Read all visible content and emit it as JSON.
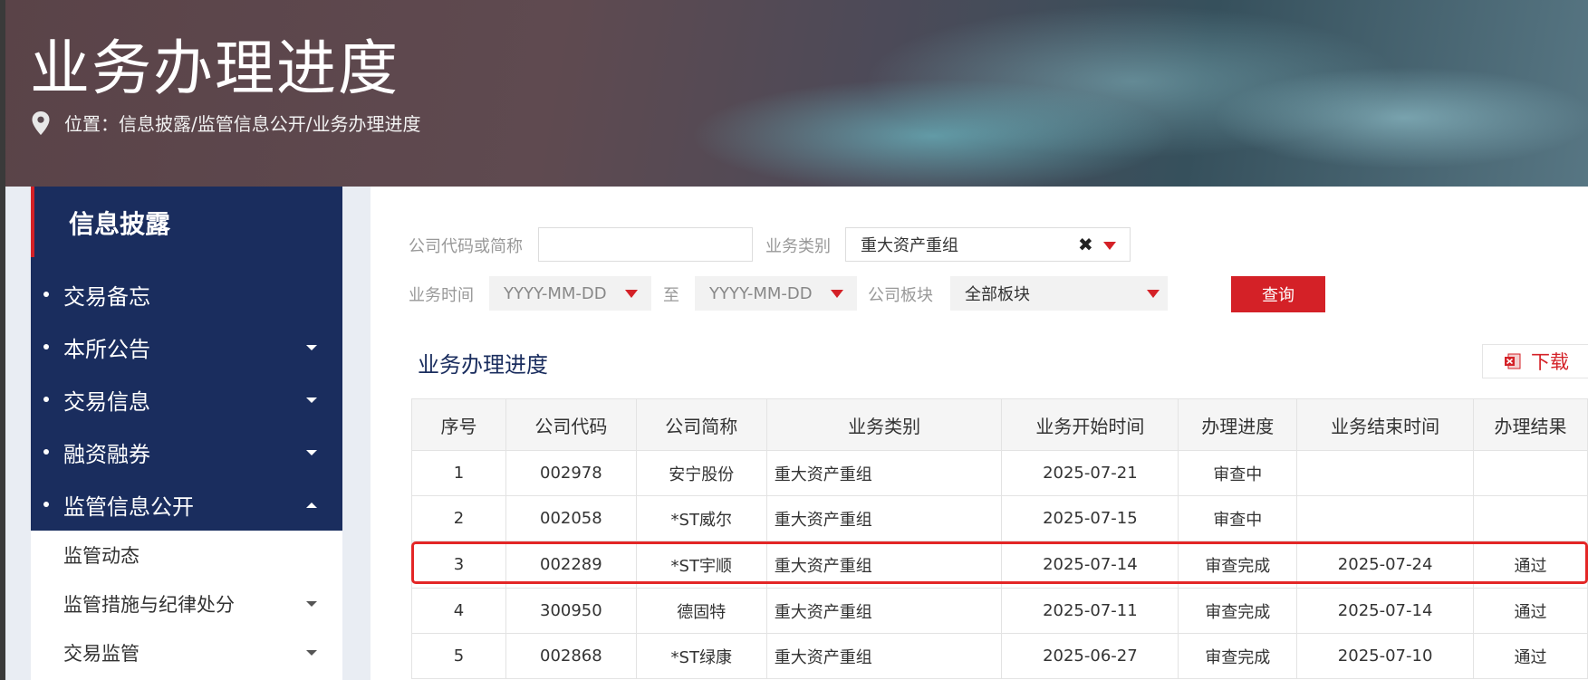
{
  "header": {
    "title": "业务办理进度",
    "breadcrumb": "位置：信息披露/监管信息公开/业务办理进度"
  },
  "sidebar": {
    "heading": "信息披露",
    "items": [
      {
        "label": "交易备忘",
        "expandable": false
      },
      {
        "label": "本所公告",
        "expandable": true
      },
      {
        "label": "交易信息",
        "expandable": true
      },
      {
        "label": "融资融券",
        "expandable": true
      },
      {
        "label": "监管信息公开",
        "expandable": true,
        "expanded": true
      }
    ],
    "subitems": [
      {
        "label": "监管动态"
      },
      {
        "label": "监管措施与纪律处分"
      },
      {
        "label": "交易监管"
      }
    ]
  },
  "filters": {
    "company_label": "公司代码或简称",
    "company_value": "",
    "biz_type_label": "业务类别",
    "biz_type_value": "重大资产重组",
    "biz_time_label": "业务时间",
    "date_from_placeholder": "YYYY-MM-DD",
    "to_label": "至",
    "date_to_placeholder": "YYYY-MM-DD",
    "board_label": "公司板块",
    "board_value": "全部板块",
    "query_button": "查询"
  },
  "section": {
    "title": "业务办理进度",
    "download_label": "下载"
  },
  "table": {
    "columns": [
      "序号",
      "公司代码",
      "公司简称",
      "业务类别",
      "业务开始时间",
      "办理进度",
      "业务结束时间",
      "办理结果"
    ],
    "rows": [
      [
        "1",
        "002978",
        "安宁股份",
        "重大资产重组",
        "2025-07-21",
        "审查中",
        "",
        ""
      ],
      [
        "2",
        "002058",
        "*ST威尔",
        "重大资产重组",
        "2025-07-15",
        "审查中",
        "",
        ""
      ],
      [
        "3",
        "002289",
        "*ST宇顺",
        "重大资产重组",
        "2025-07-14",
        "审查完成",
        "2025-07-24",
        "通过"
      ],
      [
        "4",
        "300950",
        "德固特",
        "重大资产重组",
        "2025-07-11",
        "审查完成",
        "2025-07-14",
        "通过"
      ],
      [
        "5",
        "002868",
        "*ST绿康",
        "重大资产重组",
        "2025-06-27",
        "审查完成",
        "2025-07-10",
        "通过"
      ]
    ],
    "highlighted_row": 3
  },
  "colors": {
    "brand_red": "#d42127",
    "nav_blue": "#1a2d5e",
    "highlight_border": "#e32626"
  }
}
